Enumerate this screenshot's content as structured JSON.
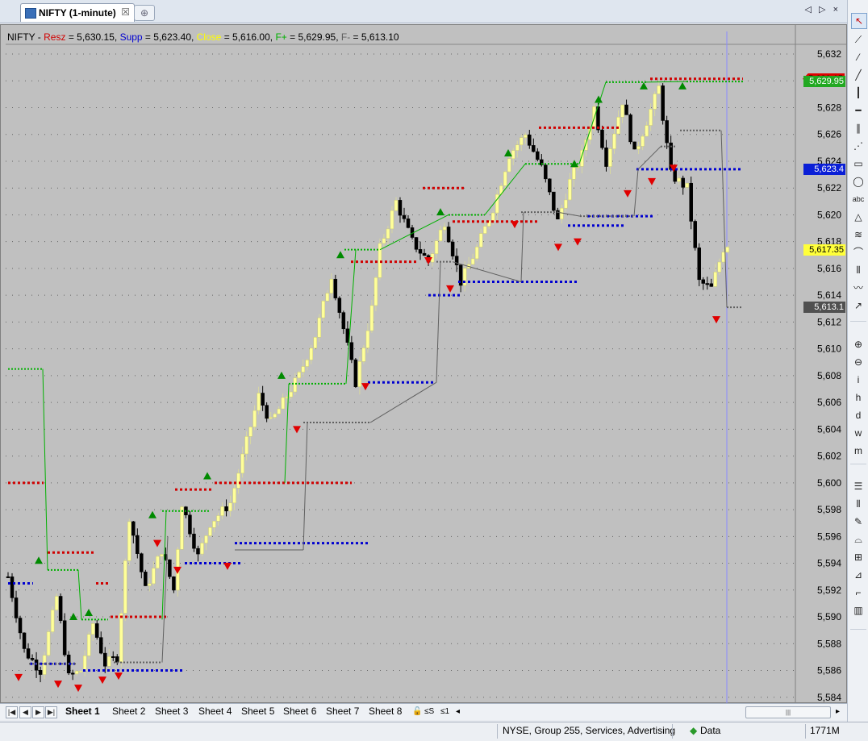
{
  "window": {
    "tab_title": "NIFTY (1-minute)",
    "close_glyph": "☒",
    "new_tab_glyph": "⊕",
    "nav_arrows": "◁ ▷ ×"
  },
  "chart_header": {
    "symbol": "NIFTY",
    "items": [
      {
        "label": "Resz",
        "value": "5,630.15",
        "color": "#d00000"
      },
      {
        "label": "Supp",
        "value": "5,623.40",
        "color": "#0000d0"
      },
      {
        "label": "Close",
        "value": "5,616.00",
        "color": "#ffff00"
      },
      {
        "label": "F+",
        "value": "5,629.95",
        "color": "#00b000"
      },
      {
        "label": "F-",
        "value": "5,613.10",
        "color": "#606060"
      }
    ]
  },
  "price_axis": {
    "ticks": [
      "5,632",
      "5,630",
      "5,628",
      "5,626",
      "5,624",
      "5,622",
      "5,620",
      "5,618",
      "5,616",
      "5,614",
      "5,612",
      "5,610",
      "5,608",
      "5,606",
      "5,604",
      "5,602",
      "5,600",
      "5,598",
      "5,596",
      "5,594",
      "5,592",
      "5,590",
      "5,588",
      "5,586",
      "5,584"
    ],
    "labels": [
      {
        "text": "5,630.15",
        "price": 5630.15,
        "bg": "#e00000",
        "fg": "#000000"
      },
      {
        "text": "5,629.95",
        "price": 5629.95,
        "bg": "#22a822",
        "fg": "#ffffff"
      },
      {
        "text": "5,623.4",
        "price": 5623.4,
        "bg": "#0a1fd6",
        "fg": "#ffffff"
      },
      {
        "text": "5,617.35",
        "price": 5617.35,
        "bg": "#ffff3a",
        "fg": "#000000"
      },
      {
        "text": "5,613.1",
        "price": 5613.1,
        "bg": "#505050",
        "fg": "#ffffff"
      }
    ]
  },
  "chart_data": {
    "type": "candlestick",
    "title": "",
    "ylim": [
      5583.5,
      5634
    ],
    "grid": true,
    "grid_style": "dotted",
    "up_color": "#ffff99",
    "down_color": "#000000",
    "background": "#c0c0c0",
    "series_colors": {
      "resz": "#d00000",
      "supp": "#0000d0",
      "fplus": "#00b000",
      "fminus": "#606060"
    }
  },
  "sheets": {
    "nav": [
      "|◀",
      "◀",
      "▶",
      "▶|"
    ],
    "tabs": [
      "Sheet 1",
      "Sheet 2",
      "Sheet 3",
      "Sheet 4",
      "Sheet 5",
      "Sheet 6",
      "Sheet 7",
      "Sheet 8"
    ],
    "active": "Sheet 1",
    "extra": [
      "🔓",
      "≤S",
      "≤1",
      "◂"
    ],
    "scroll_grip": "|||",
    "scroll_right": "▸"
  },
  "status": {
    "market": "NYSE, Group 255, Services, Advertising",
    "data_label": "Data",
    "memory": "1771M"
  },
  "toolbar_icons": [
    {
      "name": "select-cursor-icon",
      "glyph": "↖"
    },
    {
      "name": "line-icon",
      "glyph": "⟋"
    },
    {
      "name": "ray-icon",
      "glyph": "⁄"
    },
    {
      "name": "extended-line-icon",
      "glyph": "╱"
    },
    {
      "name": "vertical-line-icon",
      "glyph": "┃"
    },
    {
      "name": "horizontal-line-icon",
      "glyph": "━"
    },
    {
      "name": "parallel-lines-icon",
      "glyph": "∥"
    },
    {
      "name": "fan-icon",
      "glyph": "⋰"
    },
    {
      "name": "rectangle-icon",
      "glyph": "▭"
    },
    {
      "name": "ellipse-icon",
      "glyph": "◯"
    },
    {
      "name": "text-icon",
      "glyph": "abc"
    },
    {
      "name": "triangle-icon",
      "glyph": "△"
    },
    {
      "name": "fibonacci-icon",
      "glyph": "≋"
    },
    {
      "name": "arc-icon",
      "glyph": "⌒"
    },
    {
      "name": "cycles-icon",
      "glyph": "⦀"
    },
    {
      "name": "polyline-icon",
      "glyph": "〰"
    },
    {
      "name": "arrow-icon",
      "glyph": "↗"
    },
    {
      "name": "zoom-in-icon",
      "glyph": "⊕"
    },
    {
      "name": "zoom-out-icon",
      "glyph": "⊖"
    },
    {
      "name": "interval-i-icon",
      "glyph": "i"
    },
    {
      "name": "interval-h-icon",
      "glyph": "h"
    },
    {
      "name": "interval-d-icon",
      "glyph": "d"
    },
    {
      "name": "interval-w-icon",
      "glyph": "w"
    },
    {
      "name": "interval-m-icon",
      "glyph": "m"
    },
    {
      "name": "hlines-icon",
      "glyph": "☰"
    },
    {
      "name": "vlines-icon",
      "glyph": "⦀"
    },
    {
      "name": "pencil-icon",
      "glyph": "✎"
    },
    {
      "name": "signal-icon",
      "glyph": "⌓"
    },
    {
      "name": "grid-icon",
      "glyph": "⊞"
    },
    {
      "name": "measure-icon",
      "glyph": "⊿"
    },
    {
      "name": "ruler-icon",
      "glyph": "⌐"
    },
    {
      "name": "columns-icon",
      "glyph": "▥"
    }
  ]
}
